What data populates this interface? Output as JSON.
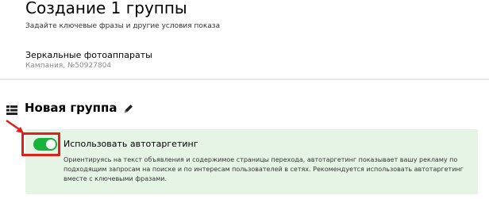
{
  "page": {
    "title": "Создание 1 группы",
    "subtitle": "Задайте ключевые фразы и другие условия показа"
  },
  "campaign": {
    "name": "Зеркальные фотоаппараты",
    "meta": "Кампания, №50927804"
  },
  "group": {
    "title": "Новая группа",
    "list_icon": "list-icon",
    "edit_icon": "pencil-icon"
  },
  "autotargeting": {
    "label": "Использовать автотаргетинг",
    "enabled": true,
    "description": "Ориентируясь на текст объявления и содержимое страницы перехода, автотаргетинг показывает вашу рекламу по подходящим запросам на поиске и по интересам пользователей в сетях. Рекомендуется использовать автотаргетинг вместе с ключевыми фразами."
  },
  "annotation": {
    "arrow_icon": "red-arrow-icon",
    "highlight_color": "#e0201b"
  },
  "colors": {
    "panel_background": "#e6f4e6",
    "toggle_on": "#18b33c"
  }
}
